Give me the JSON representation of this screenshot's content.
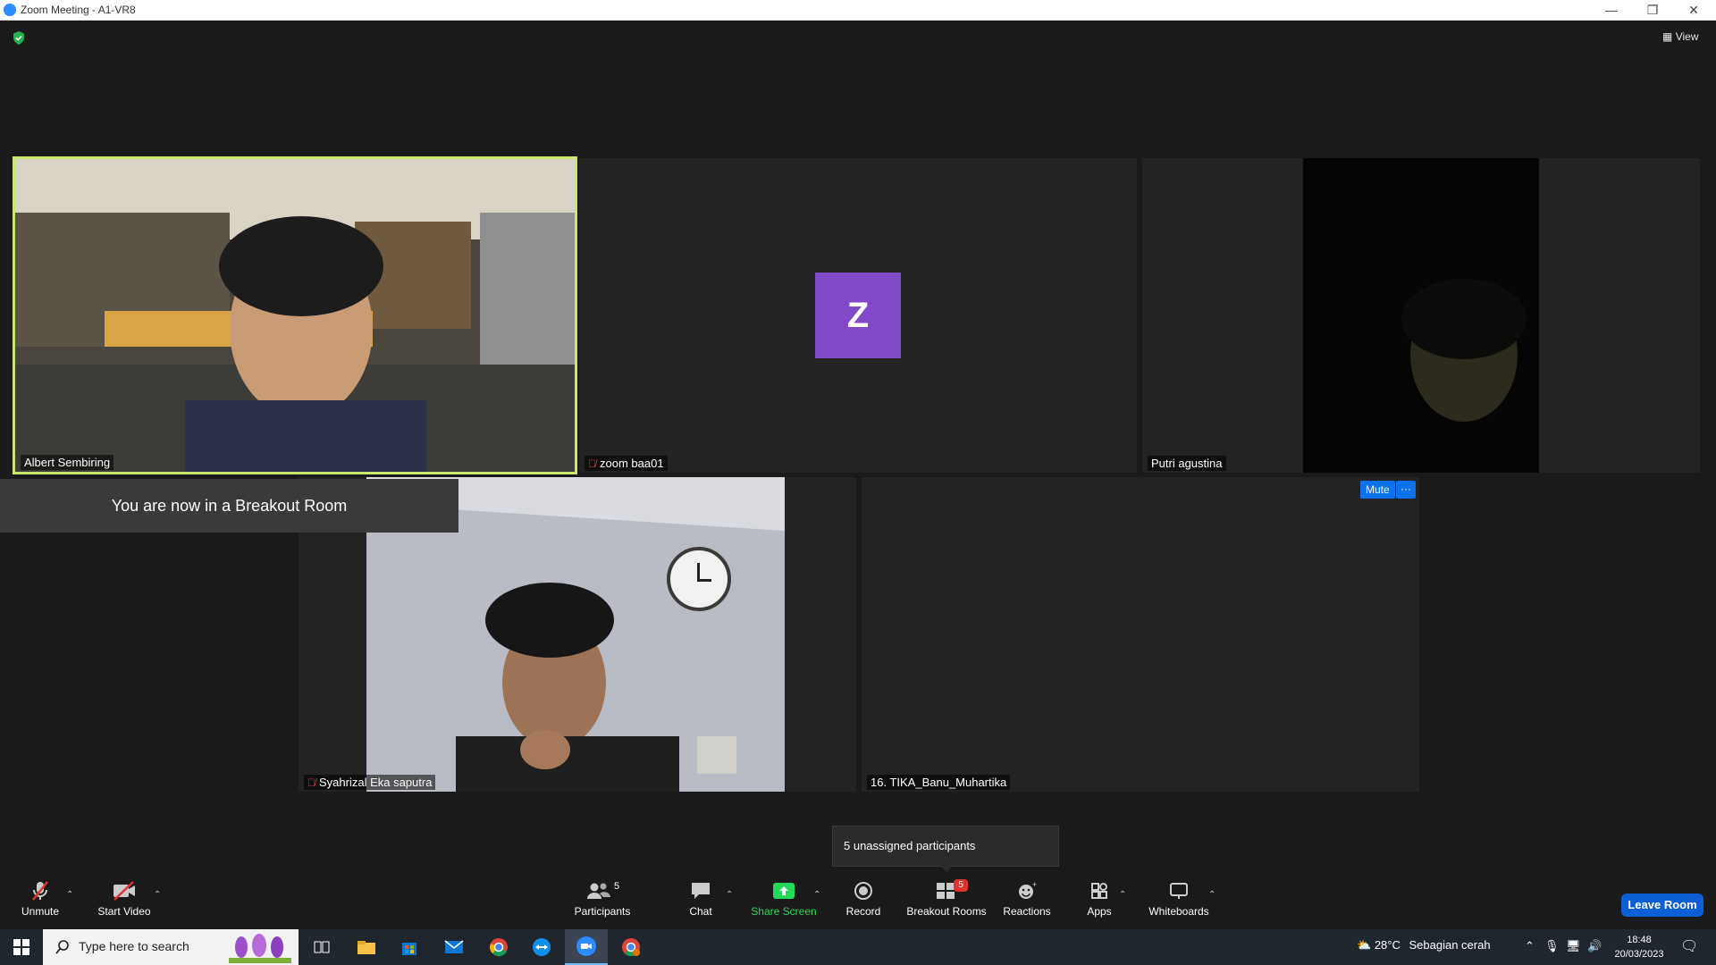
{
  "window": {
    "title": "Zoom Meeting - A1-VR8"
  },
  "header": {
    "view_label": "View"
  },
  "tiles": {
    "albert": {
      "name": "Albert Sembiring"
    },
    "zoom": {
      "name": "zoom baa01",
      "avatar_letter": "Z"
    },
    "putri": {
      "name": "Putri agustina"
    },
    "syahrizal": {
      "name": "Syahrizal Eka saputra"
    },
    "tika": {
      "name": "16. TIKA_Banu_Muhartika",
      "mute_label": "Mute",
      "more_label": "···"
    }
  },
  "toast": {
    "breakout_message": "You are now in a Breakout Room"
  },
  "popup": {
    "unassigned": "5 unassigned participants"
  },
  "toolbar": {
    "unmute": "Unmute",
    "start_video": "Start Video",
    "participants": "Participants",
    "participants_count": "5",
    "chat": "Chat",
    "share_screen": "Share Screen",
    "record": "Record",
    "breakout_rooms": "Breakout Rooms",
    "breakout_badge": "5",
    "reactions": "Reactions",
    "apps": "Apps",
    "whiteboards": "Whiteboards",
    "leave_room": "Leave Room"
  },
  "taskbar": {
    "search_placeholder": "Type here to search",
    "weather_temp": "28°C",
    "weather_desc": "Sebagian cerah",
    "time": "18:48",
    "date": "20/03/2023"
  },
  "colors": {
    "active_speaker_border": "#c9e86b",
    "avatar_bg": "#8148c7",
    "share_green": "#23d959",
    "accent_blue": "#0e72ed",
    "badge_red": "#e0332e"
  }
}
